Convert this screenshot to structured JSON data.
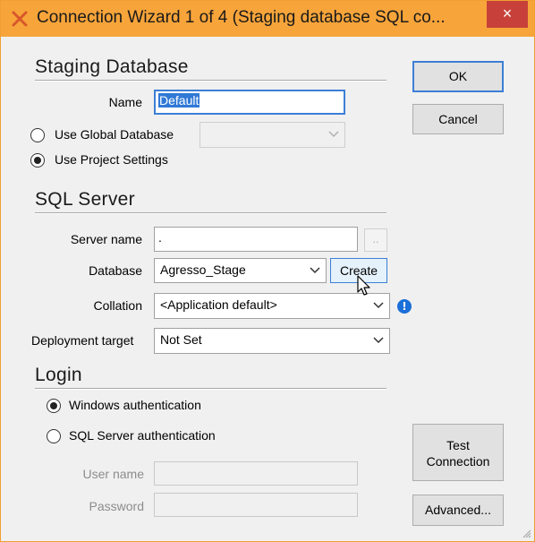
{
  "window": {
    "title": "Connection Wizard 1 of 4 (Staging database SQL co...",
    "close_glyph": "×"
  },
  "staging": {
    "section_title": "Staging Database",
    "name_label": "Name",
    "name_value": "Default",
    "use_global_label": "Use Global Database",
    "global_value": "",
    "use_project_label": "Use Project Settings",
    "selected_option": "use_project"
  },
  "sql_server": {
    "section_title": "SQL Server",
    "server_name_label": "Server name",
    "server_name_value": ".",
    "browse_label": "..",
    "database_label": "Database",
    "database_value": "Agresso_Stage",
    "create_label": "Create",
    "collation_label": "Collation",
    "collation_value": "<Application default>",
    "deployment_label": "Deployment target",
    "deployment_value": "Not Set"
  },
  "login": {
    "section_title": "Login",
    "windows_auth_label": "Windows authentication",
    "sql_auth_label": "SQL Server authentication",
    "selected_option": "windows",
    "username_label": "User name",
    "username_value": "",
    "password_label": "Password",
    "password_value": ""
  },
  "buttons": {
    "ok": "OK",
    "cancel": "Cancel",
    "test_line1": "Test",
    "test_line2": "Connection",
    "advanced": "Advanced..."
  },
  "colors": {
    "titlebar": "#f7a43a",
    "close": "#c7413a",
    "accent": "#3c7fd6",
    "info": "#1a6fd8"
  },
  "icons": {
    "app": "tool-x-icon",
    "info": "info-icon",
    "dropdown": "chevron-down-icon"
  }
}
